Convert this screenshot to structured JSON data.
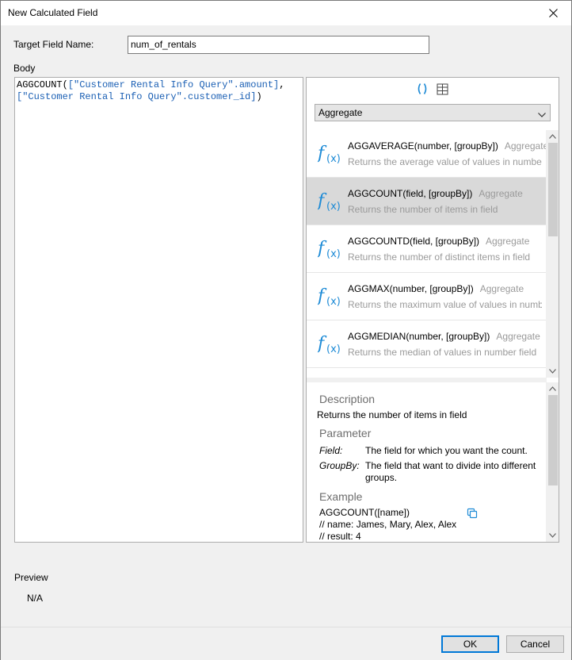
{
  "window": {
    "title": "New Calculated Field"
  },
  "form": {
    "target_label": "Target Field Name:",
    "target_value": "num_of_rentals",
    "body_label": "Body"
  },
  "editor": {
    "line1_fn": "AGGCOUNT(",
    "line1_str": "[\"Customer Rental Info Query\".amount]",
    "line1_end": ",",
    "line2_str": "[\"Customer Rental Info Query\".customer_id]",
    "line2_end": ")"
  },
  "panel": {
    "category_selected": "Aggregate",
    "functions": [
      {
        "signature": "AGGAVERAGE(number, [groupBy])",
        "category": "Aggregate",
        "description": "Returns the average value of values in number"
      },
      {
        "signature": "AGGCOUNT(field, [groupBy])",
        "category": "Aggregate",
        "description": "Returns the number of items in field"
      },
      {
        "signature": "AGGCOUNTD(field, [groupBy])",
        "category": "Aggregate",
        "description": "Returns the number of distinct items in field"
      },
      {
        "signature": "AGGMAX(number, [groupBy])",
        "category": "Aggregate",
        "description": "Returns the maximum value of values in number"
      },
      {
        "signature": "AGGMEDIAN(number, [groupBy])",
        "category": "Aggregate",
        "description": "Returns the median of values in number field"
      }
    ],
    "selected_index": 1
  },
  "details": {
    "description_title": "Description",
    "description_text": "Returns the number of items in field",
    "parameter_title": "Parameter",
    "params": [
      {
        "name": "Field:",
        "text": "The field for which you want the count."
      },
      {
        "name": "GroupBy:",
        "text": "The field that want to divide into different groups."
      }
    ],
    "example_title": "Example",
    "example_lines": [
      "AGGCOUNT([name])",
      "// name: James, Mary, Alex, Alex",
      "// result: 4"
    ]
  },
  "preview": {
    "label": "Preview",
    "value": "N/A"
  },
  "buttons": {
    "ok": "OK",
    "cancel": "Cancel"
  },
  "colors": {
    "accent": "#0078d7",
    "function_icon": "#1e8bd6",
    "string": "#1a5fb4",
    "selected_row": "#d9d9d9"
  }
}
